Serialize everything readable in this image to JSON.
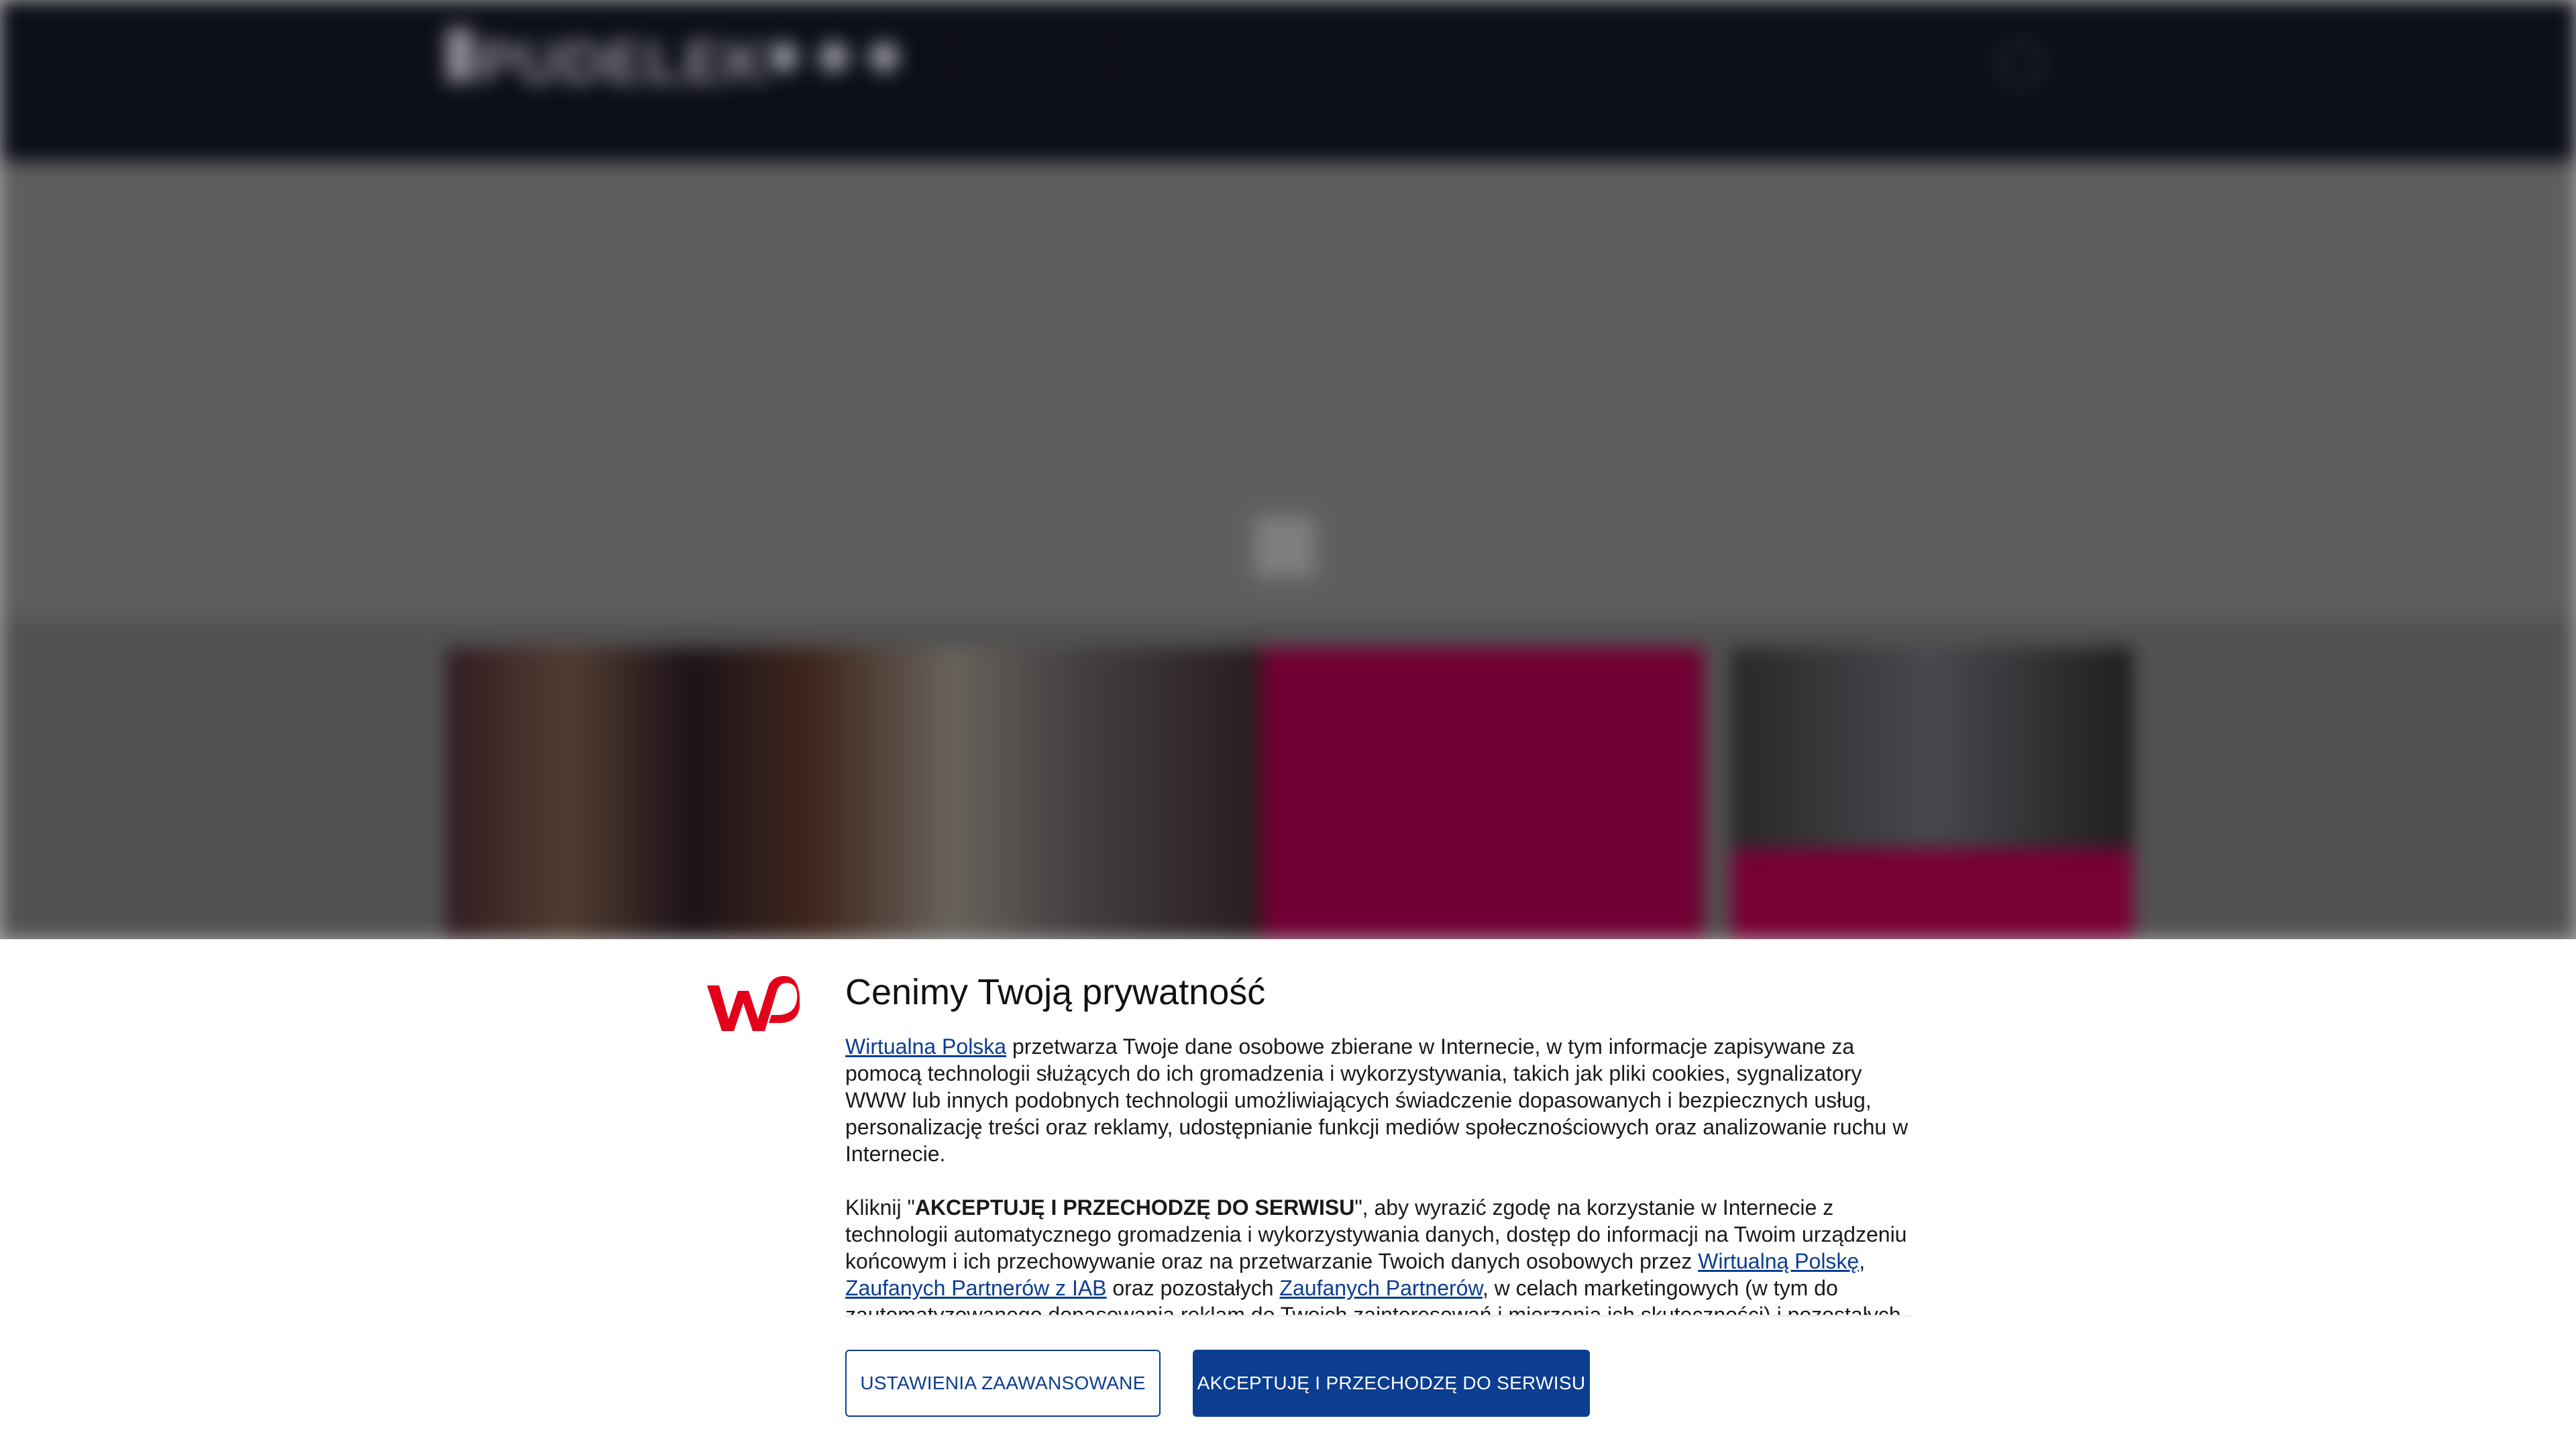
{
  "background_page": {
    "logo_text": "PUDELEK",
    "pill_label": "",
    "user_label": "",
    "nav_items": [
      "",
      "",
      "",
      "",
      "",
      "",
      "",
      ""
    ],
    "hero_headline": "",
    "side_headline": ""
  },
  "consent": {
    "title": "Cenimy Twoją prywatność",
    "paragraph1": {
      "link_wp": "Wirtualna Polska",
      "text": " przetwarza Twoje dane osobowe zbierane w Internecie, w tym informacje zapisywane za pomocą technologii służących do ich gromadzenia i wykorzystywania, takich jak pliki cookies, sygnalizatory WWW lub innych podobnych technologii umożliwiających świadczenie dopasowanych i bezpiecznych usług, personalizację treści oraz reklamy, udostępnianie funkcji mediów społecznościowych oraz analizowanie ruchu w Internecie."
    },
    "paragraph2": {
      "lead": "Kliknij \"",
      "bold": "AKCEPTUJĘ I PRZECHODZĘ DO SERWISU",
      "after_bold": "\", aby wyrazić zgodę na korzystanie w Internecie z technologii automatycznego gromadzenia i wykorzystywania danych, dostęp do informacji na Twoim urządzeniu końcowym i ich przechowywanie oraz na przetwarzanie Twoich danych osobowych przez ",
      "link_wp": "Wirtualną Polskę",
      "comma": ", ",
      "link_iab": "Zaufanych Partnerów z IAB",
      "middle": " oraz pozostałych ",
      "link_partners": "Zaufanych Partnerów",
      "tail": ", w celach marketingowych (w tym do zautomatyzowanego dopasowania reklam do Twoich zainteresowań i mierzenia ich skuteczności) i pozostałych, które wskazujemy poniżej."
    },
    "buttons": {
      "advanced": "USTAWIENIA ZAAWANSOWANE",
      "accept": "AKCEPTUJĘ I PRZECHODZĘ DO SERWISU"
    }
  },
  "colors": {
    "wp_red": "#e3001b",
    "accent_blue": "#0b3d91",
    "header_bg": "#121626",
    "pink": "#a8004d"
  }
}
